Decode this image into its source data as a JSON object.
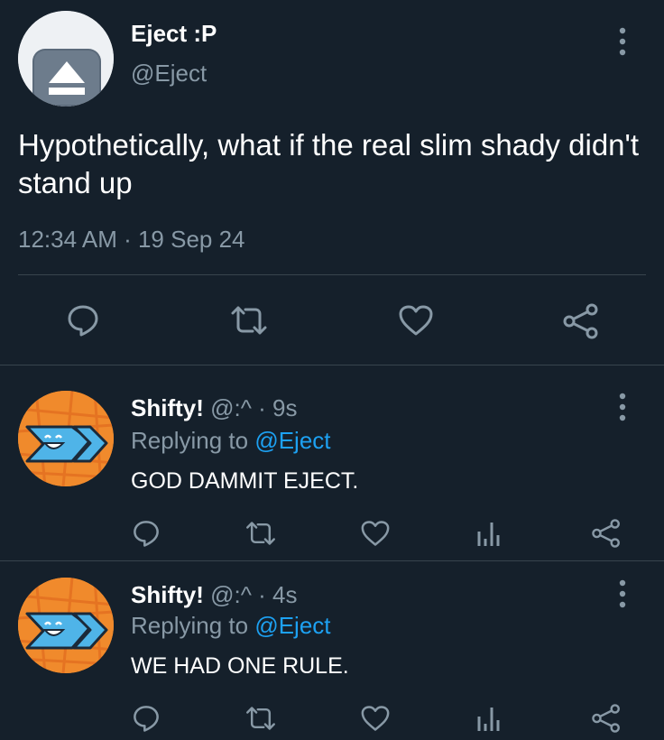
{
  "main_tweet": {
    "display_name": "Eject :P",
    "handle": "@Eject",
    "text": "Hypothetically, what if the real slim shady didn't stand up",
    "timestamp": "12:34 AM · 19 Sep 24",
    "avatar_icon": "eject-icon",
    "actions": [
      "reply-icon",
      "retweet-icon",
      "like-icon",
      "share-icon"
    ]
  },
  "replies": [
    {
      "display_name": "Shifty!",
      "meta": " @:^ · 9s",
      "replying_prefix": "Replying to ",
      "replying_mention": "@Eject",
      "text": "GOD DAMMIT EJECT."
    },
    {
      "display_name": "Shifty!",
      "meta": " @:^ · 4s",
      "replying_prefix": "Replying to ",
      "replying_mention": "@Eject",
      "text": "WE HAD ONE RULE."
    }
  ],
  "colors": {
    "background": "#15202b",
    "secondary_text": "#8899a6",
    "link": "#1da1f2",
    "divider": "#38444d",
    "avatar_orange": "#f08a2c",
    "avatar_blue": "#4fb4e8"
  }
}
